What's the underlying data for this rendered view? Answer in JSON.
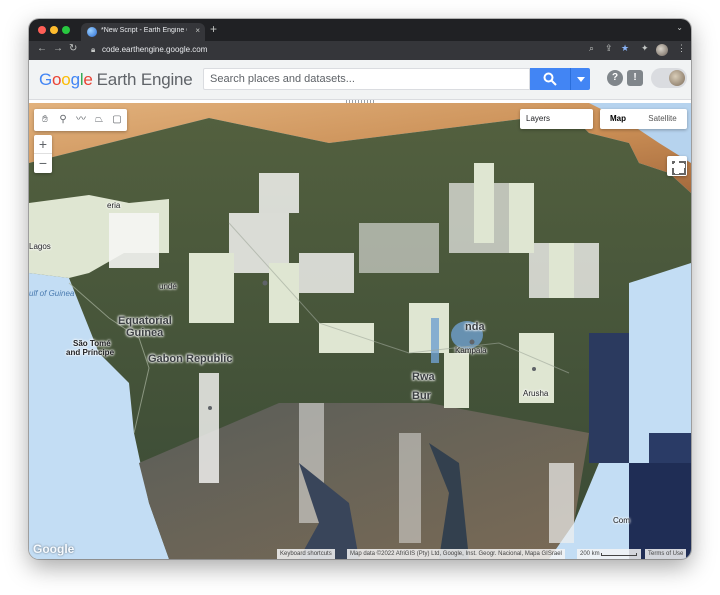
{
  "browser": {
    "tab_title": "*New Script - Earth Engine Co",
    "tab_close": "×",
    "new_tab": "+",
    "tab_menu": "⌄",
    "url": "code.earthengine.google.com",
    "nav_back": "←",
    "nav_forward": "→",
    "nav_reload": "↻",
    "icons": [
      "lock-icon",
      "zoom-icon",
      "share-icon",
      "star-icon",
      "extensions-icon",
      "profile-icon",
      "menu-icon"
    ]
  },
  "header": {
    "logo_google": [
      "G",
      "o",
      "o",
      "g",
      "l",
      "e"
    ],
    "logo_product": "Earth Engine",
    "search_placeholder": "Search places and datasets...",
    "help_label": "?",
    "feedback_label": "!"
  },
  "map": {
    "layers_label": "Layers",
    "map_type_map": "Map",
    "map_type_satellite": "Satellite",
    "zoom_in": "+",
    "zoom_out": "−",
    "labels": {
      "equatorial": "Equatorial",
      "guinea": "Guinea",
      "gabon": "Gabon",
      "republic": "Republic",
      "sao_tome": "São Tomé",
      "and_principe": "and Príncipe",
      "gulf_of_guinea": "ulf of Guinea",
      "lagos": "Lagos",
      "yaounde": "undé",
      "kampala": "Kampala",
      "uganda": "nda",
      "rwanda": "Rwa",
      "burundi": "Bur",
      "arusha": "Arusha",
      "comoros": "Com",
      "nigeria_frag": "eria"
    },
    "watermark": "Google",
    "keyboard_shortcuts": "Keyboard shortcuts",
    "map_data": "Map data ©2022 AfriGIS (Pty) Ltd, Google, Inst. Geogr. Nacional, Mapa GISrael",
    "scale": "200 km",
    "terms": "Terms of Use"
  },
  "colors": {
    "accent": "#4285f4",
    "ocean": "#c3ddf4",
    "land": "#dfe6d2"
  }
}
